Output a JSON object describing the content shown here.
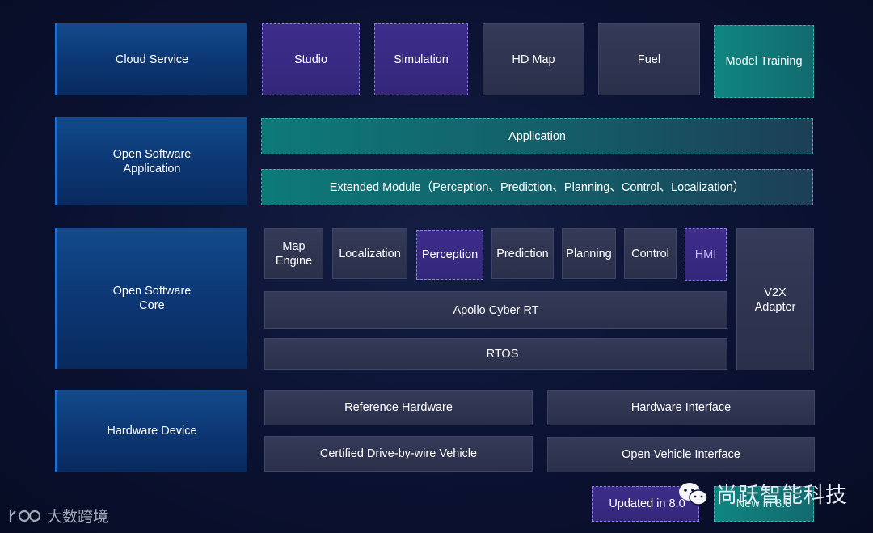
{
  "layers": {
    "cloud": "Cloud Service",
    "app": "Open Software\nApplication",
    "core": "Open Software\nCore",
    "hw": "Hardware Device"
  },
  "cloud": {
    "studio": "Studio",
    "simulation": "Simulation",
    "hdmap": "HD Map",
    "fuel": "Fuel",
    "training": "Model Training"
  },
  "app": {
    "application": "Application",
    "extended": "Extended Module（Perception、Prediction、Planning、Control、Localization）"
  },
  "core": {
    "map_engine": "Map\nEngine",
    "localization": "Localization",
    "perception": "Perception",
    "prediction": "Prediction",
    "planning": "Planning",
    "control": "Control",
    "hmi": "HMI",
    "v2x": "V2X\nAdapter",
    "cyber": "Apollo Cyber RT",
    "rtos": "RTOS"
  },
  "hw": {
    "ref": "Reference Hardware",
    "iface": "Hardware Interface",
    "vehicle": "Certified Drive-by-wire Vehicle",
    "ovi": "Open Vehicle Interface"
  },
  "legend": {
    "updated": "Updated in 8.0",
    "new": "New in 8.0"
  },
  "watermark": {
    "right": "尚跃智能科技",
    "left": "大数跨境"
  },
  "colors": {
    "layer": "#0c3672",
    "gray": "#2f3450",
    "updated": "#3e2d8c",
    "new": "#0f8580"
  }
}
